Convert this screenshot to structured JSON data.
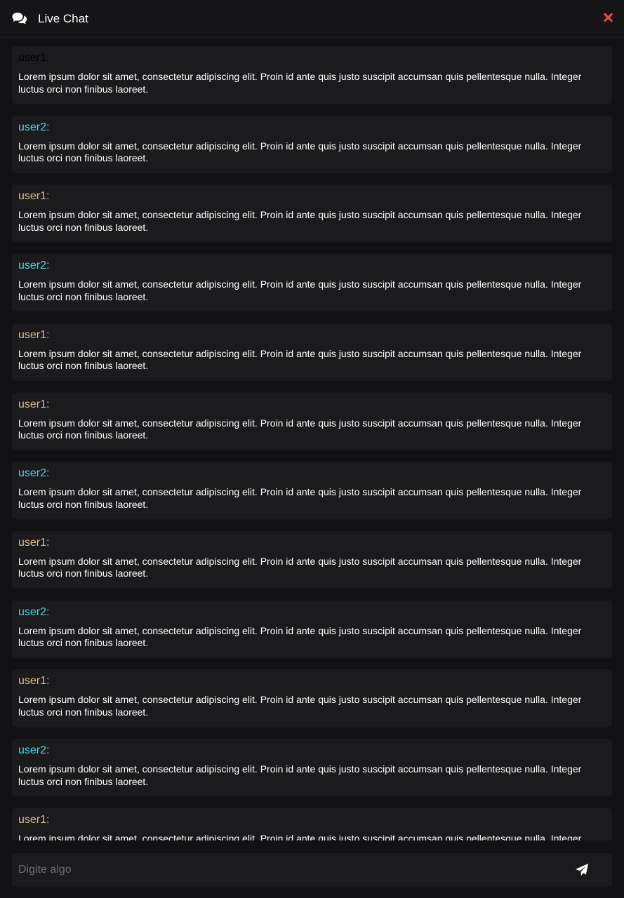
{
  "header": {
    "title": "Live Chat",
    "icon": "comments-icon",
    "close_icon": "close-icon",
    "close_color": "#e5484d"
  },
  "messages": [
    {
      "user": "user1:",
      "style": "u0",
      "text": "Lorem ipsum dolor sit amet, consectetur adipiscing elit. Proin id ante quis justo suscipit accumsan quis pellentesque nulla. Integer luctus orci non finibus laoreet."
    },
    {
      "user": "user2:",
      "style": "u2",
      "text": "Lorem ipsum dolor sit amet, consectetur adipiscing elit. Proin id ante quis justo suscipit accumsan quis pellentesque nulla. Integer luctus orci non finibus laoreet."
    },
    {
      "user": "user1:",
      "style": "u1",
      "text": "Lorem ipsum dolor sit amet, consectetur adipiscing elit. Proin id ante quis justo suscipit accumsan quis pellentesque nulla. Integer luctus orci non finibus laoreet."
    },
    {
      "user": "user2:",
      "style": "u2",
      "text": "Lorem ipsum dolor sit amet, consectetur adipiscing elit. Proin id ante quis justo suscipit accumsan quis pellentesque nulla. Integer luctus orci non finibus laoreet."
    },
    {
      "user": "user1:",
      "style": "u1",
      "text": "Lorem ipsum dolor sit amet, consectetur adipiscing elit. Proin id ante quis justo suscipit accumsan quis pellentesque nulla. Integer luctus orci non finibus laoreet."
    },
    {
      "user": "user1:",
      "style": "u1",
      "text": "Lorem ipsum dolor sit amet, consectetur adipiscing elit. Proin id ante quis justo suscipit accumsan quis pellentesque nulla. Integer luctus orci non finibus laoreet."
    },
    {
      "user": "user2:",
      "style": "u2",
      "text": "Lorem ipsum dolor sit amet, consectetur adipiscing elit. Proin id ante quis justo suscipit accumsan quis pellentesque nulla. Integer luctus orci non finibus laoreet."
    },
    {
      "user": "user1:",
      "style": "u1",
      "text": "Lorem ipsum dolor sit amet, consectetur adipiscing elit. Proin id ante quis justo suscipit accumsan quis pellentesque nulla. Integer luctus orci non finibus laoreet."
    },
    {
      "user": "user2:",
      "style": "u2",
      "text": "Lorem ipsum dolor sit amet, consectetur adipiscing elit. Proin id ante quis justo suscipit accumsan quis pellentesque nulla. Integer luctus orci non finibus laoreet."
    },
    {
      "user": "user1:",
      "style": "u1",
      "text": "Lorem ipsum dolor sit amet, consectetur adipiscing elit. Proin id ante quis justo suscipit accumsan quis pellentesque nulla. Integer luctus orci non finibus laoreet."
    },
    {
      "user": "user2:",
      "style": "u2",
      "text": "Lorem ipsum dolor sit amet, consectetur adipiscing elit. Proin id ante quis justo suscipit accumsan quis pellentesque nulla. Integer luctus orci non finibus laoreet."
    },
    {
      "user": "user1:",
      "style": "u1",
      "text": "Lorem ipsum dolor sit amet, consectetur adipiscing elit. Proin id ante quis justo suscipit accumsan quis pellentesque nulla. Integer luctus orci non finibus laoreet."
    }
  ],
  "composer": {
    "placeholder": "Digite algo",
    "value": "",
    "send_icon": "paper-plane-icon"
  },
  "colors": {
    "background": "#121214",
    "panel": "#1b1b1d",
    "user1": "#d9bb94",
    "user2": "#3fd8e4"
  }
}
